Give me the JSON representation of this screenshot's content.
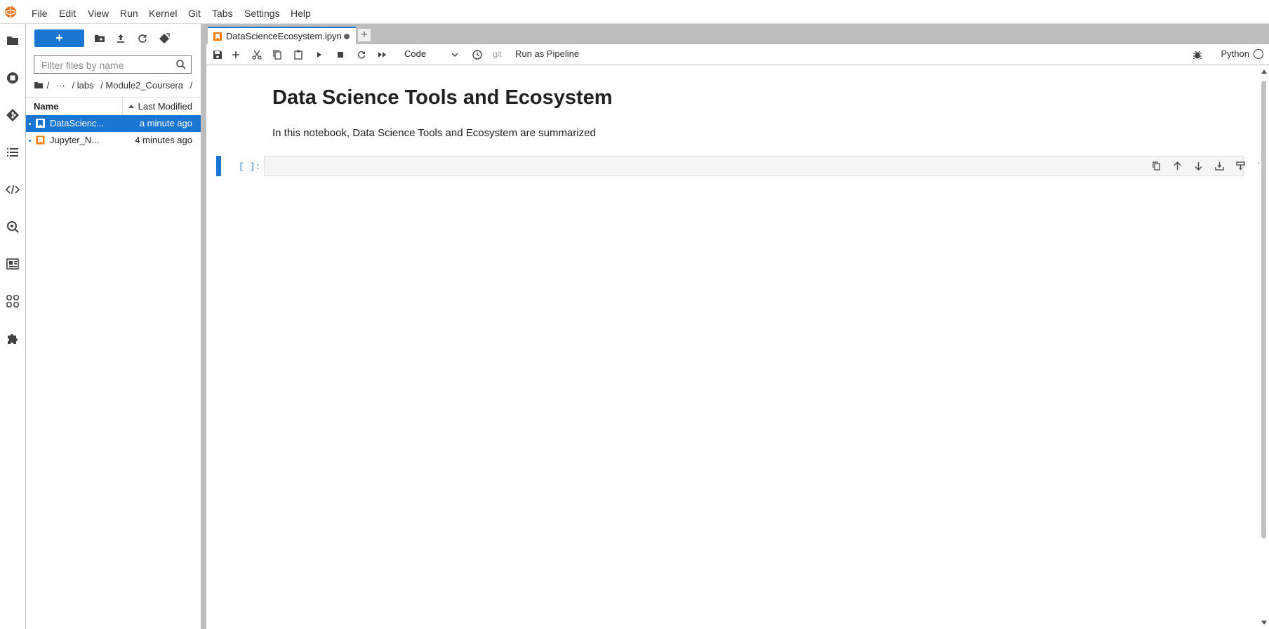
{
  "app": {
    "logo_icon": "jupyter-logo-icon"
  },
  "menu": [
    "File",
    "Edit",
    "View",
    "Run",
    "Kernel",
    "Git",
    "Tabs",
    "Settings",
    "Help"
  ],
  "activity_bar": [
    "folder-icon",
    "running-icon",
    "git-icon",
    "toc-icon",
    "code-icon",
    "property-inspector-icon",
    "templates-icon",
    "extensions-grid-icon",
    "puzzle-icon"
  ],
  "file_browser": {
    "new_label": "+",
    "filter_placeholder": "Filter files by name",
    "breadcrumb": [
      "/",
      "···",
      "/ labs",
      "/ Module2_Coursera",
      "/"
    ],
    "columns": {
      "name": "Name",
      "modified": "Last Modified"
    },
    "files": [
      {
        "name": "DataScienc...",
        "modified": "a minute ago",
        "selected": true
      },
      {
        "name": "Jupyter_N...",
        "modified": "4 minutes ago",
        "selected": false
      }
    ]
  },
  "tabs": [
    {
      "label": "DataScienceEcosystem.ipyn",
      "active": true,
      "modified": true
    }
  ],
  "toolbar": {
    "cell_type": "Code",
    "git_label": "git",
    "pipeline_label": "Run as Pipeline",
    "kernel_name": "Python"
  },
  "notebook": {
    "title": "Data Science Tools and Ecosystem",
    "intro": "In this notebook, Data Science Tools and Ecosystem are summarized",
    "code_cell_prompt": "[ ]:"
  },
  "colors": {
    "accent": "#1976d2",
    "notebook_icon": "#f57c00"
  }
}
